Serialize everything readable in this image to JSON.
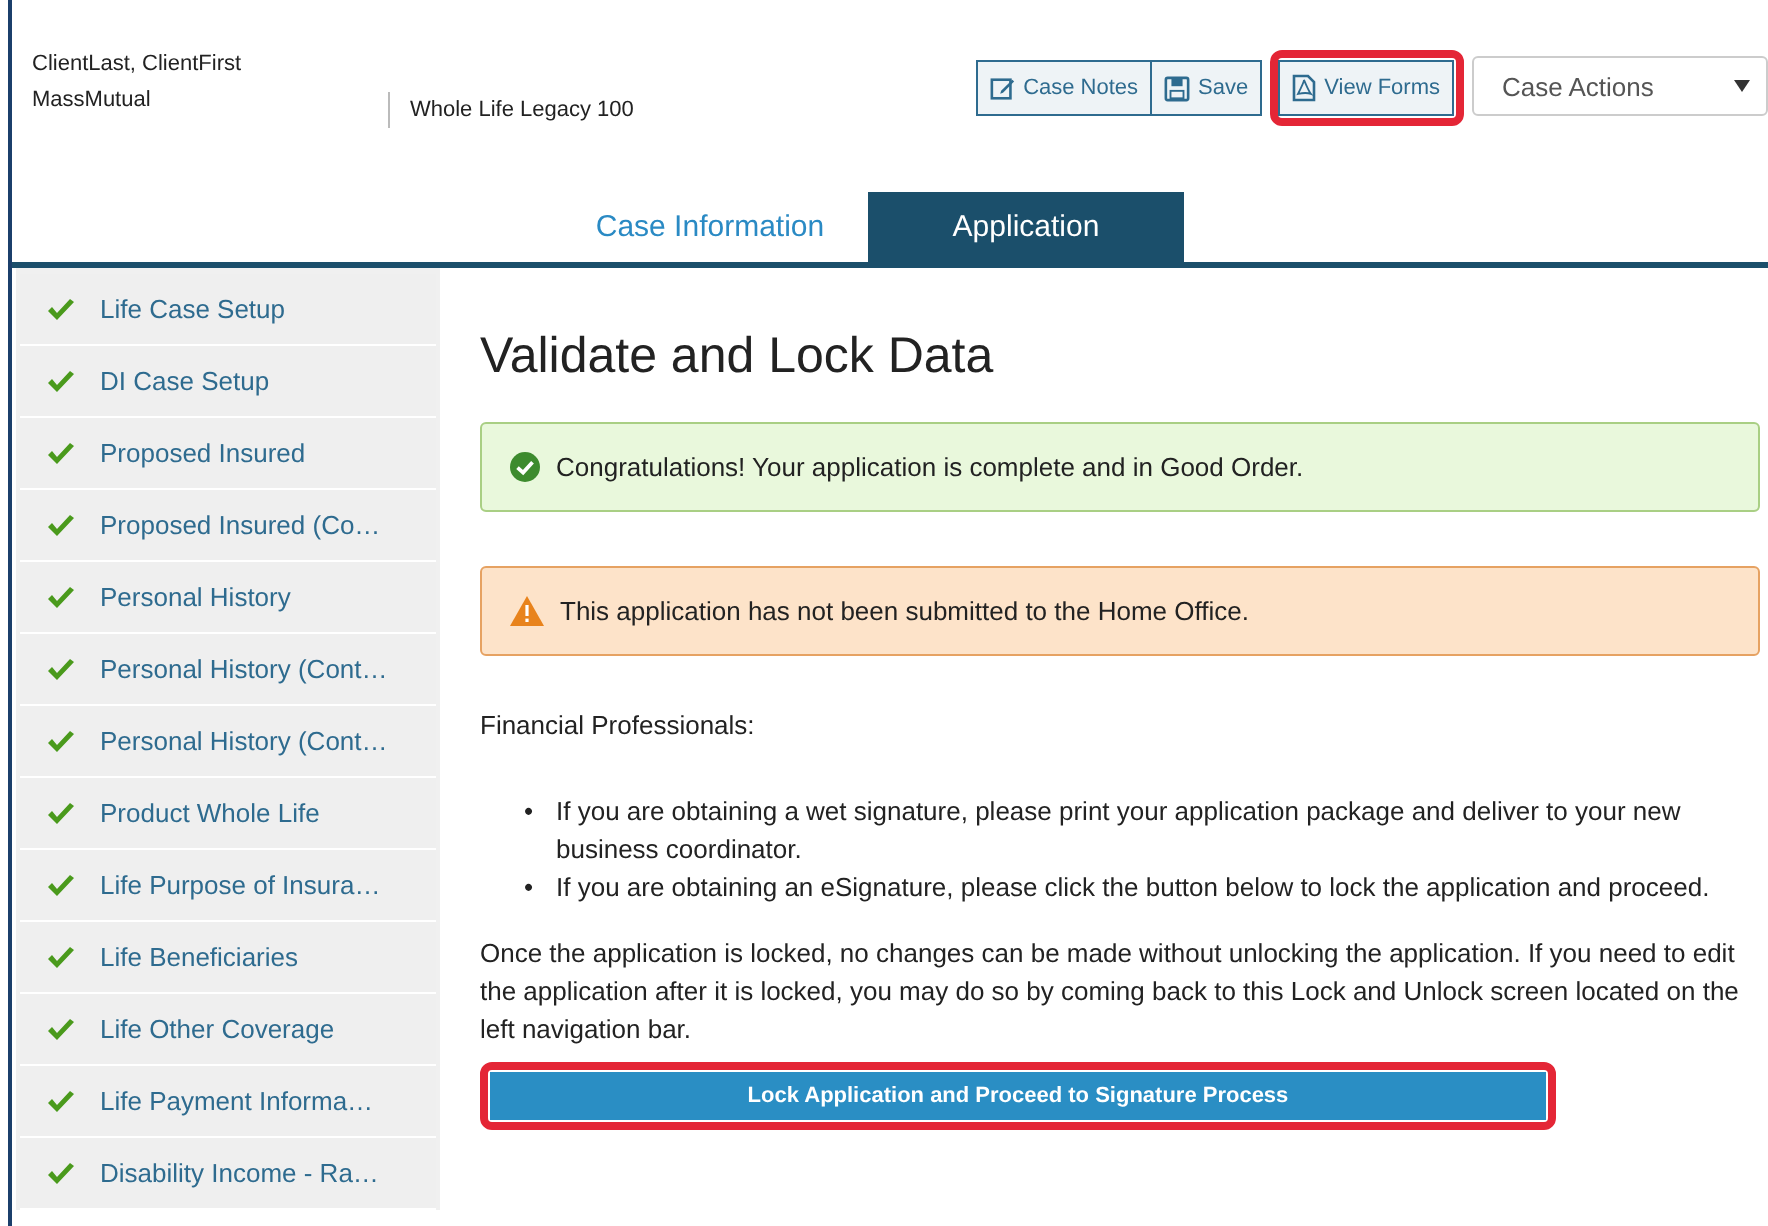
{
  "header": {
    "client_name": "ClientLast, ClientFirst",
    "carrier": "MassMutual",
    "product": "Whole Life Legacy 100",
    "buttons": [
      {
        "kind": "notes",
        "label": "Case Notes",
        "highlighted": false
      },
      {
        "kind": "save",
        "label": "Save",
        "highlighted": false
      },
      {
        "kind": "pdf",
        "label": "View Forms",
        "highlighted": true
      }
    ],
    "case_actions": {
      "placeholder": "Case Actions"
    }
  },
  "tabs": [
    {
      "label": "Case Information",
      "selected": false
    },
    {
      "label": "Application",
      "selected": true
    }
  ],
  "sidebar": {
    "items": [
      {
        "label": "Life Case Setup",
        "complete": true
      },
      {
        "label": "DI Case Setup",
        "complete": true
      },
      {
        "label": "Proposed Insured",
        "complete": true
      },
      {
        "label": "Proposed Insured (Co…",
        "complete": true
      },
      {
        "label": "Personal History",
        "complete": true
      },
      {
        "label": "Personal History (Cont…",
        "complete": true
      },
      {
        "label": "Personal History (Cont…",
        "complete": true
      },
      {
        "label": "Product Whole Life",
        "complete": true
      },
      {
        "label": "Life Purpose of Insura…",
        "complete": true
      },
      {
        "label": "Life Beneficiaries",
        "complete": true
      },
      {
        "label": "Life Other Coverage",
        "complete": true
      },
      {
        "label": "Life Payment Informa…",
        "complete": true
      },
      {
        "label": "Disability Income - Ra…",
        "complete": true
      }
    ]
  },
  "main": {
    "title": "Validate and Lock Data",
    "alerts": [
      {
        "kind": "success",
        "text": "Congratulations! Your application is complete and in Good Order."
      },
      {
        "kind": "warning",
        "text": "This application has not been submitted to the Home Office."
      }
    ],
    "intro": "Financial Professionals:",
    "bullets": [
      {
        "marker": "•",
        "text": "If you are obtaining a wet signature, please print your application package and deliver to your new business coordinator."
      },
      {
        "marker": "•",
        "text": "If you are obtaining an eSignature, please click the button below to lock the application and proceed."
      }
    ],
    "note": "Once the application is locked, no changes can be made without unlocking the application. If you need to edit the application after it is locked, you may do so by coming back to this Lock and Unlock screen located on the left navigation bar.",
    "lock_button": {
      "label": "Lock Application and Proceed to Signature Process",
      "highlighted": true
    }
  }
}
